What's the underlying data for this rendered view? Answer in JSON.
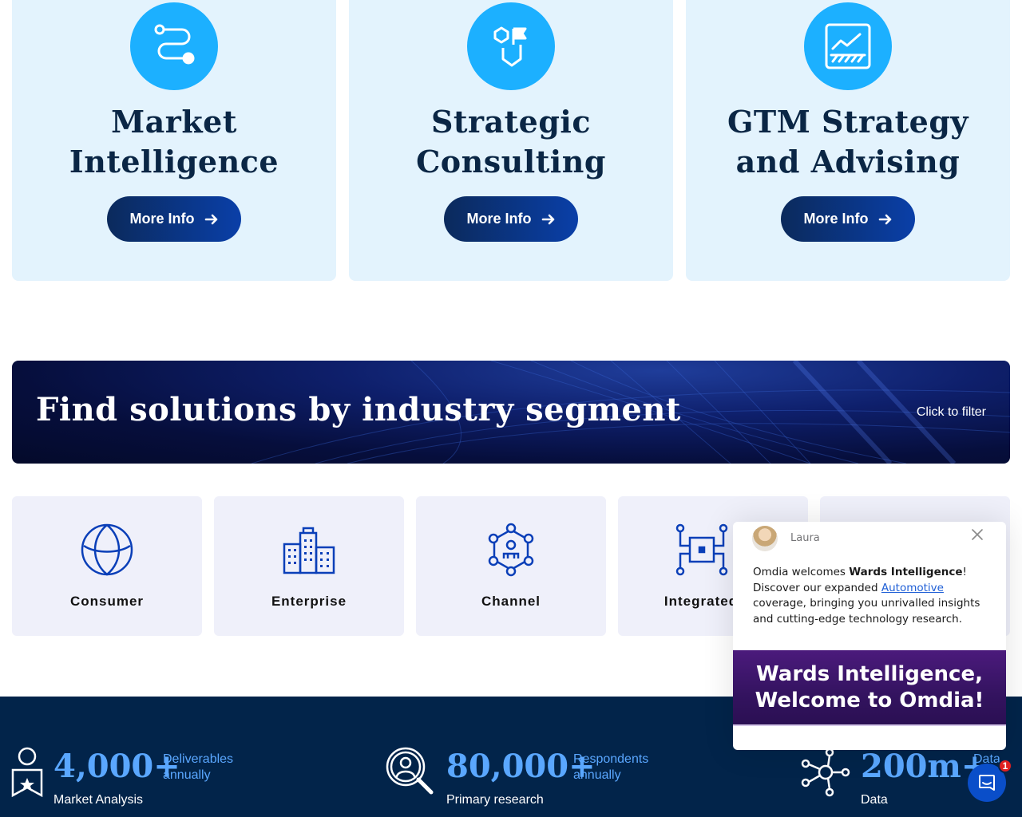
{
  "services": [
    {
      "title_line1": "Market",
      "title_line2": "Intelligence",
      "button": "More Info",
      "icon": "route-icon"
    },
    {
      "title_line1": "Strategic",
      "title_line2": "Consulting",
      "button": "More Info",
      "icon": "strategy-flag-icon"
    },
    {
      "title_line1": "GTM Strategy",
      "title_line2": "and Advising",
      "button": "More Info",
      "icon": "chart-trend-icon"
    }
  ],
  "banner": {
    "title": "Find solutions by industry segment",
    "filter_label": "Click to filter"
  },
  "segments": [
    {
      "label": "Consumer",
      "icon": "globe-icon"
    },
    {
      "label": "Enterprise",
      "icon": "buildings-icon"
    },
    {
      "label": "Channel",
      "icon": "network-hub-icon"
    },
    {
      "label": "Integrated",
      "icon": "circuit-icon"
    }
  ],
  "stats": [
    {
      "number": "4,000+",
      "desc_line1": "Deliverables",
      "desc_line2": "annually",
      "label": "Market Analysis",
      "icon": "award-icon"
    },
    {
      "number": "80,000+",
      "desc_line1": "Respondents",
      "desc_line2": "annually",
      "label": "Primary research",
      "icon": "magnifier-person-icon"
    },
    {
      "number": "200m+",
      "desc_line1": "Data",
      "desc_line2": "",
      "label": "Data",
      "icon": "data-network-icon"
    }
  ],
  "chat": {
    "agent_name": "Laura",
    "msg_part1": "Omdia welcomes ",
    "msg_bold": "Wards Intelligence",
    "msg_part2": "! Discover our expanded ",
    "msg_link": "Automotive",
    "msg_part3": " coverage, bringing you unrivalled insights and cutting-edge technology research.",
    "promo_line1": "Wards Intelligence,",
    "promo_line2": "Welcome to Omdia!"
  },
  "launcher": {
    "badge_count": "1"
  },
  "colors": {
    "card_bg": "#e3f3fd",
    "icon_circle": "#1cb0ff",
    "heading": "#0a2645",
    "button": "#0b2a5c",
    "stats_bg": "#02244a",
    "stat_accent": "#5aa7ff",
    "segment_bg": "#eff0fa",
    "promo_purple": "#4b1a7c"
  }
}
